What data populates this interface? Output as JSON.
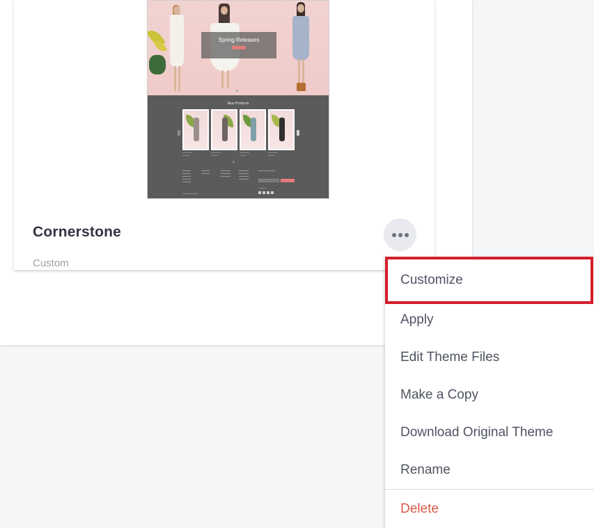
{
  "theme_card": {
    "name": "Cornerstone",
    "type": "Custom",
    "more_icon": "ellipsis-horizontal-icon",
    "thumbnail": {
      "hero_title": "Spring Releases",
      "section_title": "New Products"
    }
  },
  "menu": {
    "items": [
      {
        "label": "Customize"
      },
      {
        "label": "Apply"
      },
      {
        "label": "Edit Theme Files"
      },
      {
        "label": "Make a Copy"
      },
      {
        "label": "Download Original Theme"
      },
      {
        "label": "Rename"
      }
    ],
    "delete_label": "Delete"
  },
  "colors": {
    "highlight_border": "#d41f2b",
    "delete_text": "#d85a47",
    "page_background": "#f5f6f8"
  }
}
